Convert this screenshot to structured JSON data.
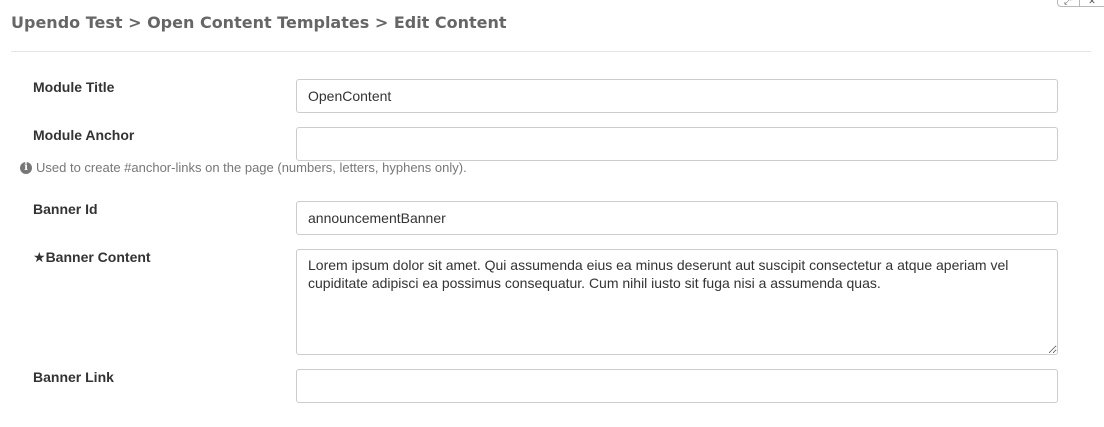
{
  "breadcrumb": {
    "site": "Upendo Test",
    "sep1": ">",
    "module": "Open Content Templates",
    "sep2": ">",
    "page": "Edit Content"
  },
  "window_controls": [
    "expand-icon",
    "close-icon"
  ],
  "form": {
    "module_title": {
      "label": "Module Title",
      "value": "OpenContent"
    },
    "module_anchor": {
      "label": "Module Anchor",
      "value": "",
      "help": "Used to create #anchor-links on the page (numbers, letters, hyphens only).",
      "help_icon": "info-icon"
    },
    "banner_id": {
      "label": "Banner Id",
      "value": "announcementBanner"
    },
    "banner_content": {
      "required_marker": "★",
      "label": "Banner Content",
      "value": "Lorem ipsum dolor sit amet. Qui assumenda eius ea minus deserunt aut suscipit consectetur a atque aperiam vel cupiditate adipisci ea possimus consequatur. Cum nihil iusto sit fuga nisi a assumenda quas."
    },
    "banner_link": {
      "label": "Banner Link",
      "value": ""
    }
  }
}
